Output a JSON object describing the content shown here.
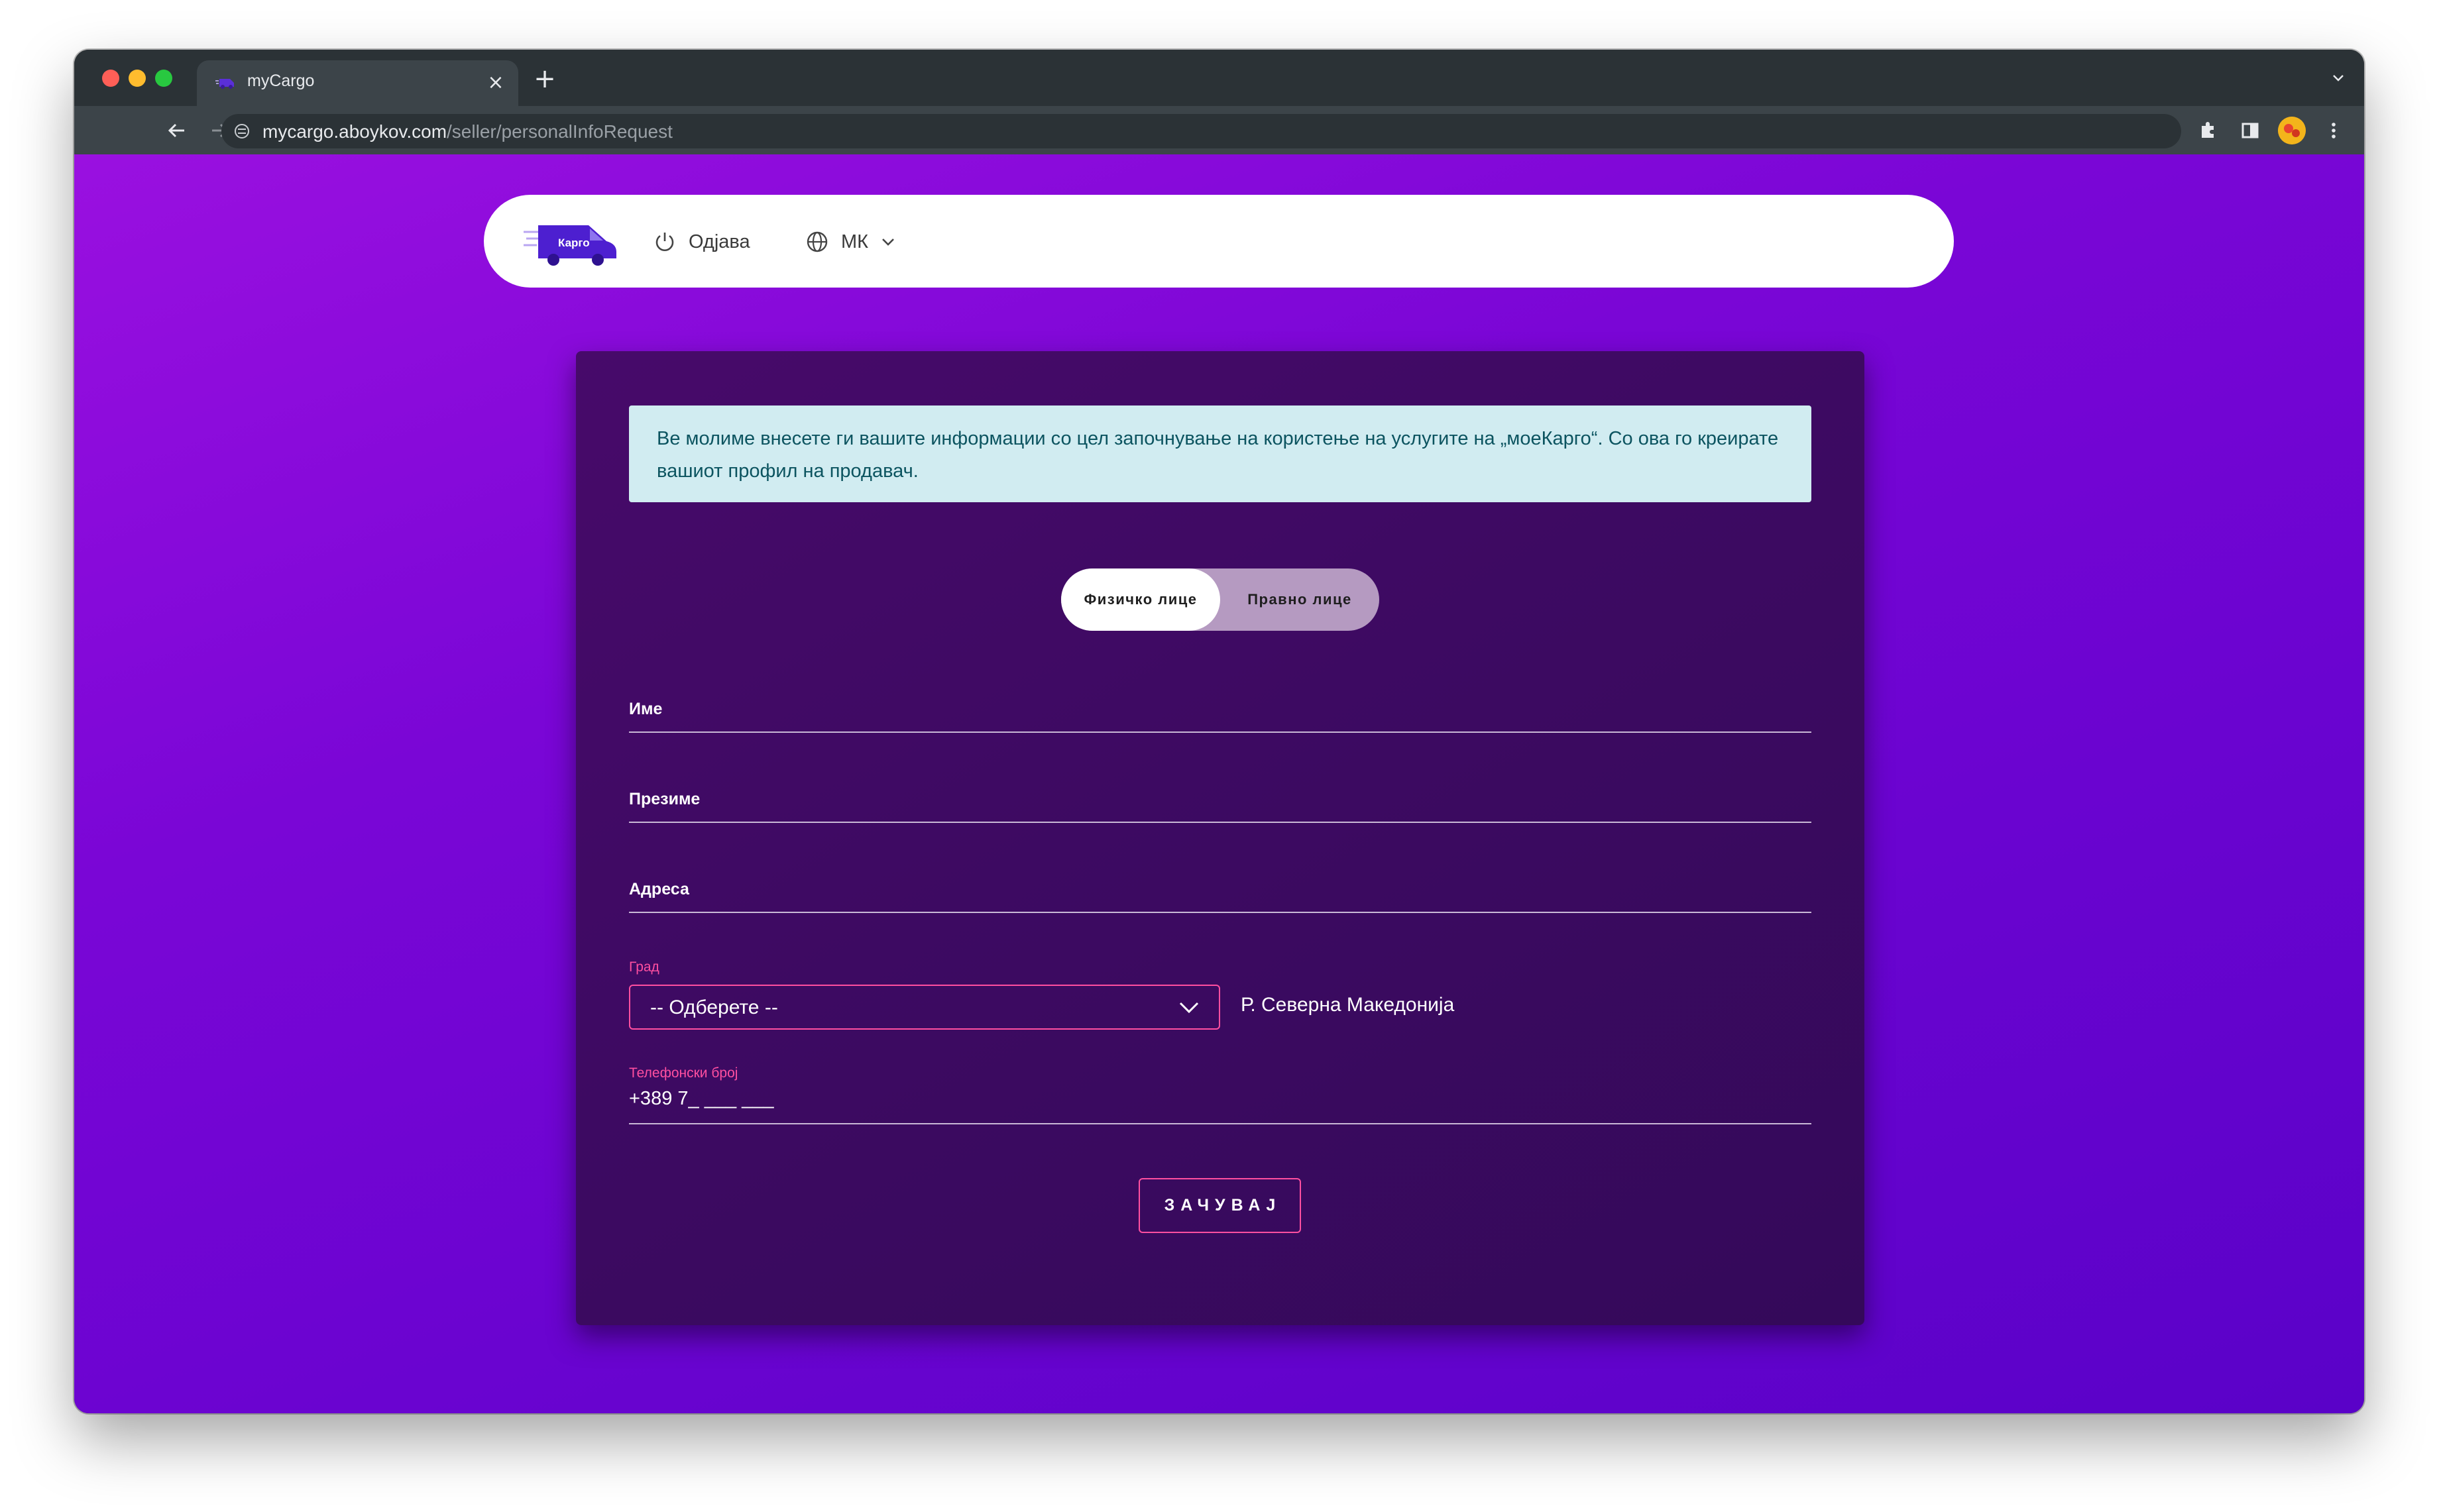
{
  "browser": {
    "tab_title": "myCargo",
    "tab_close": "×",
    "new_tab": "+",
    "url_host": "mycargo.aboykov.com",
    "url_path": "/seller/personalInfoRequest"
  },
  "navbar": {
    "logo_text": "Карго",
    "logout_label": "Одјава",
    "language_label": "МК"
  },
  "form": {
    "notice": "Ве молиме внесете ги вашите информации со цел започнување на користење на услугите на „моеКарго“. Со ова го креирате вашиот профил на продавач.",
    "toggle": {
      "active": "Физичко лице",
      "inactive": "Правно лице"
    },
    "fields": {
      "first_name": "Име",
      "last_name": "Презиме",
      "address": "Адреса"
    },
    "city": {
      "label": "Град",
      "selected": "-- Одберете --"
    },
    "country": "Р. Северна Македонија",
    "phone": {
      "label": "Телефонски број",
      "value": "+389 7_ ___ ___"
    },
    "save_label": "ЗАЧУВАЈ"
  },
  "colors": {
    "accent_pink": "#ff4fa0",
    "brand_purple": "#7a06d6",
    "notice_bg": "#d1ecf1"
  }
}
